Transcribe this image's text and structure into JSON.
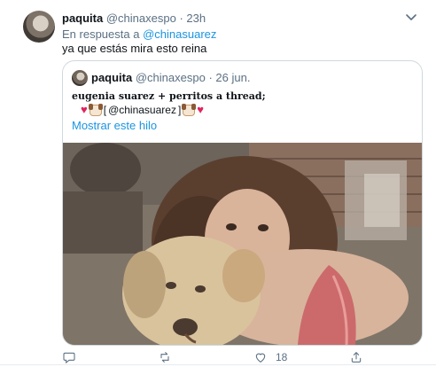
{
  "tweet": {
    "display_name": "paquita",
    "handle": "@chinaxespo",
    "time": "23h",
    "reply_prefix": "En respuesta a",
    "reply_handle": "@chinasuarez",
    "text": "ya que estás mira esto reina",
    "likes": "18"
  },
  "quote": {
    "display_name": "paquita",
    "handle": "@chinaxespo",
    "date": "26 jun.",
    "title": "eugenia suarez + perritos a thread;",
    "line_open": "[ ",
    "line_handle": "@chinasuarez",
    "line_close": " ]",
    "show_thread": "Mostrar este hilo"
  },
  "icons": {
    "more": "chevron-down-icon",
    "reply": "reply-icon",
    "retweet": "retweet-icon",
    "like": "heart-icon",
    "share": "share-icon"
  },
  "colors": {
    "link": "#1b95e0",
    "muted": "#5b7083",
    "heart": "#e0245e",
    "border": "#cfd9de"
  }
}
